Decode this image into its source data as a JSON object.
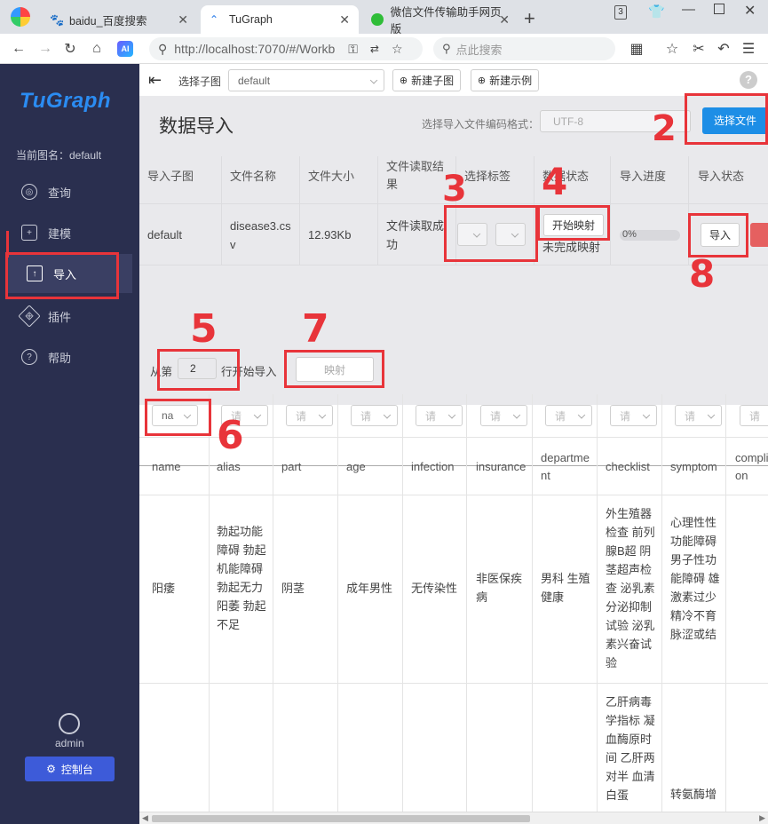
{
  "browser": {
    "tabs": [
      {
        "label": "baidu_百度搜索"
      },
      {
        "label": "TuGraph"
      },
      {
        "label": "微信文件传输助手网页版"
      }
    ],
    "new_tab": "+",
    "url": "http://localhost:7070/#/Workb",
    "search_placeholder": "点此搜索",
    "badge": "3"
  },
  "sidebar": {
    "logo": "TuGraph",
    "current_graph": "当前图名：default",
    "items": [
      {
        "label": "查询"
      },
      {
        "label": "建模"
      },
      {
        "label": "导入"
      },
      {
        "label": "插件"
      },
      {
        "label": "帮助"
      }
    ],
    "user": "admin",
    "console": "控制台"
  },
  "topbar": {
    "select_subgraph_label": "选择子图",
    "subgraph_value": "default",
    "new_subgraph": "新建子图",
    "new_example": "新建示例"
  },
  "import": {
    "title": "数据导入",
    "encoding_label": "选择导入文件编码格式：",
    "encoding_value": "UTF-8",
    "choose_file": "选择文件",
    "headers": [
      "导入子图",
      "文件名称",
      "文件大小",
      "文件读取结果",
      "选择标签",
      "数据状态",
      "导入进度",
      "导入状态"
    ],
    "row": {
      "subgraph": "default",
      "filename": "disease3.csv",
      "size": "12.93Kb",
      "read_result": "文件读取成功",
      "map_button": "开始映射",
      "map_status": "未完成映射",
      "progress": "0%",
      "progress_value": 0,
      "import_button": "导入"
    }
  },
  "mapping": {
    "start_prefix": "从第",
    "start_row": "2",
    "start_suffix": "行开始导入",
    "map_button": "映射",
    "first_select": "na",
    "select_placeholder": "请",
    "columns": [
      "name",
      "alias",
      "part",
      "age",
      "infection",
      "insurance",
      "department",
      "checklist",
      "symptom",
      "complication"
    ],
    "row1": [
      "阳痿",
      "勃起功能障碍 勃起机能障碍 勃起无力 阳萎 勃起不足",
      "阴茎",
      "成年男性",
      "无传染性",
      "非医保疾病",
      "男科 生殖健康",
      "外生殖器检查 前列腺B超 阴茎超声检查 泌乳素分泌抑制试验 泌乳素兴奋试验",
      "心理性性功能障碍 男子性功能障碍 雄激素过少 精冷不育 脉涩或结",
      ""
    ],
    "row2_checklist": "乙肝病毒学指标 凝血酶原时间 乙肝两对半 血清白蛋",
    "row2_symptom": "转氨酶增"
  },
  "annotations": [
    "1",
    "2",
    "3",
    "4",
    "5",
    "6",
    "7",
    "8"
  ],
  "colors": {
    "sidebar": "#2a2f4f",
    "primary": "#1d8ee6",
    "annotation": "#e8343a"
  }
}
